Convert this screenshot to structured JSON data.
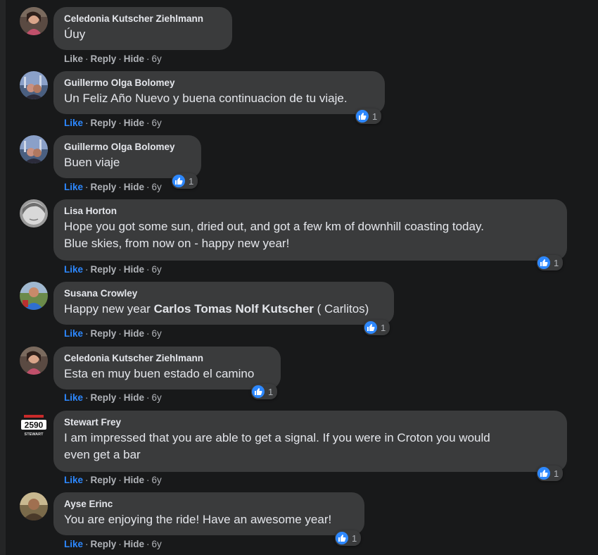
{
  "actions": {
    "like": "Like",
    "reply": "Reply",
    "hide": "Hide",
    "sep": "·"
  },
  "comments": [
    {
      "author": "Celedonia Kutscher Ziehlmann",
      "text": "Úuy",
      "time": "6y",
      "reactions": ""
    },
    {
      "author": "Guillermo Olga Bolomey",
      "text": "Un Feliz Año Nuevo y buena continuacion de tu viaje.",
      "time": "6y",
      "reactions": "1"
    },
    {
      "author": "Guillermo Olga Bolomey",
      "text": "Buen viaje",
      "time": "6y",
      "reactions": "1"
    },
    {
      "author": "Lisa Horton",
      "text_line1": "Hope you got some sun, dried out, and got a few km of downhill coasting today.",
      "text_line2": "Blue skies, from now on - happy new year!",
      "time": "6y",
      "reactions": "1"
    },
    {
      "author": "Susana Crowley",
      "text_pre": "Happy new year ",
      "mention": "Carlos Tomas Nolf Kutscher",
      "text_post": " ( Carlitos)",
      "time": "6y",
      "reactions": "1"
    },
    {
      "author": "Celedonia Kutscher Ziehlmann",
      "text": "Esta en muy buen estado el camino",
      "time": "6y",
      "reactions": "1"
    },
    {
      "author": "Stewart Frey",
      "avatar_number": "2590",
      "avatar_label": "STEWART",
      "text_line1": "I am impressed that you are able to get a signal. If you were in Croton you would",
      "text_line2": "even get a bar",
      "time": "6y",
      "reactions": "1"
    },
    {
      "author": "Ayse Erinc",
      "text": "You are enjoying the ride! Have an awesome year!",
      "time": "6y",
      "reactions": "1"
    }
  ],
  "colors": {
    "background": "#18191a",
    "bubble": "#3a3b3c",
    "text": "#e4e6eb",
    "muted": "#b0b3b8",
    "like_active": "#2d88ff"
  },
  "icons": {
    "reaction": "thumbs-up-icon"
  }
}
